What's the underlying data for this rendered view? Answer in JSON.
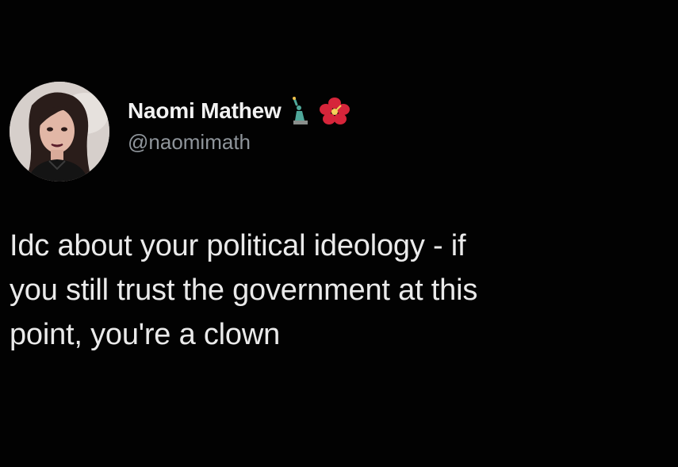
{
  "tweet": {
    "author": {
      "display_name": "Naomi Mathew",
      "handle": "@naomimath",
      "badges": [
        "statue-of-liberty-icon",
        "hibiscus-flower-icon"
      ]
    },
    "text": "Idc about your political ideology - if\nyou still trust the government at this\npoint, you're a clown"
  },
  "colors": {
    "background": "#020202",
    "text": "#eaeaea",
    "handle": "#8f959b",
    "liberty_green": "#4fa89a",
    "hibiscus_red": "#d6253a"
  }
}
